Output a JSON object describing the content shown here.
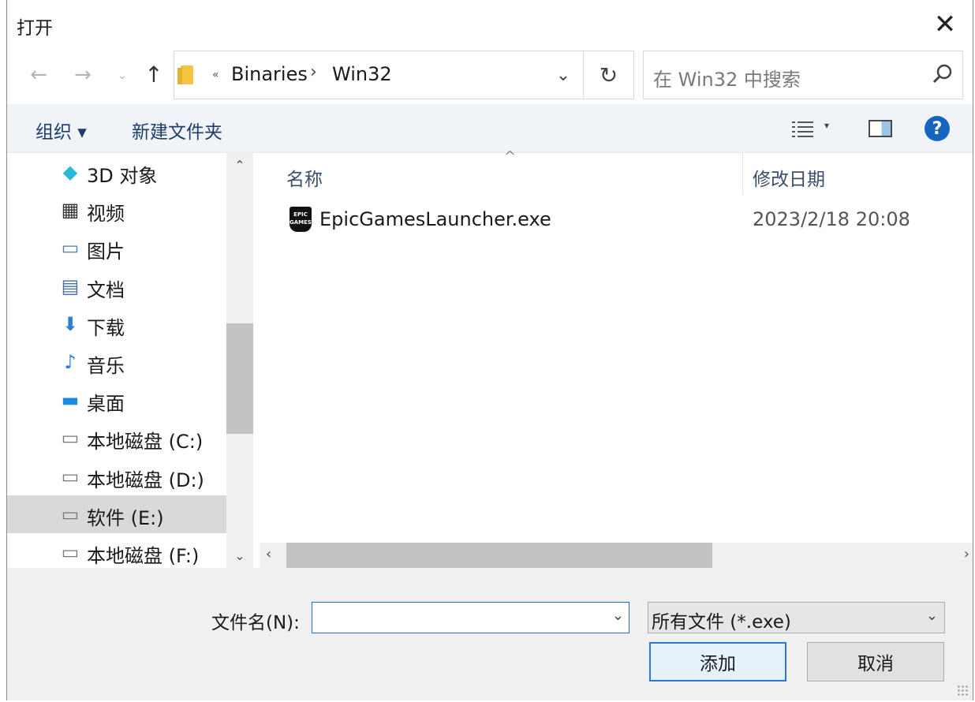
{
  "dialog": {
    "title": "打开",
    "close_glyph": "✕"
  },
  "nav": {
    "back_glyph": "←",
    "forward_glyph": "→",
    "recent_glyph": "⌄",
    "up_glyph": "↑",
    "address_chevron": "«",
    "breadcrumbs": [
      "Binaries",
      "Win32"
    ],
    "breadcrumb_separator": "›",
    "address_dropdown_glyph": "⌄",
    "refresh_glyph": "↻"
  },
  "search": {
    "placeholder": "在 Win32 中搜索",
    "icon": "search-icon"
  },
  "toolbar": {
    "organize_label": "组织 ▾",
    "new_folder_label": "新建文件夹",
    "view_dropdown_glyph": "▾",
    "help_glyph": "?"
  },
  "sidebar": {
    "items": [
      {
        "label": "3D 对象",
        "icon": "cube-icon",
        "glyph": "◆",
        "color": "#2bb7d8"
      },
      {
        "label": "视频",
        "icon": "film-icon",
        "glyph": "▦",
        "color": "#333333"
      },
      {
        "label": "图片",
        "icon": "picture-icon",
        "glyph": "▭",
        "color": "#4a7bb5"
      },
      {
        "label": "文档",
        "icon": "document-icon",
        "glyph": "▤",
        "color": "#4a6fa5"
      },
      {
        "label": "下载",
        "icon": "download-icon",
        "glyph": "⬇",
        "color": "#2b7fd8"
      },
      {
        "label": "音乐",
        "icon": "music-icon",
        "glyph": "♪",
        "color": "#2b7fd8"
      },
      {
        "label": "桌面",
        "icon": "desktop-icon",
        "glyph": "▬",
        "color": "#1e88e5"
      },
      {
        "label": "本地磁盘 (C:)",
        "icon": "system-drive-icon",
        "glyph": "▭",
        "color": "#777777"
      },
      {
        "label": "本地磁盘 (D:)",
        "icon": "drive-icon",
        "glyph": "▭",
        "color": "#777777"
      },
      {
        "label": "软件 (E:)",
        "icon": "drive-icon",
        "glyph": "▭",
        "color": "#777777"
      },
      {
        "label": "本地磁盘 (F:)",
        "icon": "drive-icon",
        "glyph": "▭",
        "color": "#777777"
      }
    ],
    "selected_index": 9,
    "scroll_up_glyph": "⌃",
    "scroll_down_glyph": "⌄"
  },
  "files": {
    "columns": [
      "名称",
      "修改日期"
    ],
    "sort_indicator": "^",
    "rows": [
      {
        "name": "EpicGamesLauncher.exe",
        "modified": "2023/2/18 20:08",
        "icon": "epic-games-icon",
        "icon_text": "EPIC GAMES"
      }
    ],
    "scroll_left_glyph": "‹",
    "scroll_right_glyph": "›"
  },
  "bottom": {
    "filename_label": "文件名(N):",
    "filename_value": "",
    "filename_dropdown_glyph": "⌄",
    "filetype_selected": "所有文件 (*.exe)",
    "filetype_dropdown_glyph": "⌄",
    "add_label": "添加",
    "cancel_label": "取消"
  },
  "colors": {
    "accent": "#1f6fd0",
    "toolbar_bg": "#f0f4f9",
    "selected_bg": "#d9d9d9"
  }
}
